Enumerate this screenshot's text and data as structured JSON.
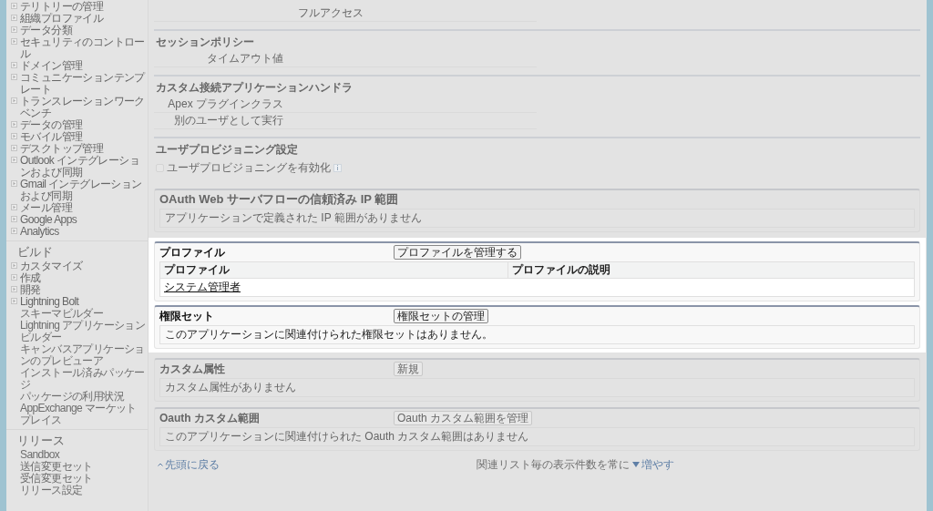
{
  "sidebar": {
    "groups": [
      {
        "items": [
          {
            "label": "テリトリーの管理",
            "kind": "folder"
          },
          {
            "label": "組織プロファイル",
            "kind": "folder"
          },
          {
            "label": "データ分類",
            "kind": "folder"
          },
          {
            "label": "セキュリティのコントロール",
            "kind": "folder"
          },
          {
            "label": "ドメイン管理",
            "kind": "folder"
          },
          {
            "label": "コミュニケーションテンプレート",
            "kind": "folder"
          },
          {
            "label": "トランスレーションワークベンチ",
            "kind": "folder"
          },
          {
            "label": "データの管理",
            "kind": "folder"
          },
          {
            "label": "モバイル管理",
            "kind": "folder"
          },
          {
            "label": "デスクトップ管理",
            "kind": "folder"
          },
          {
            "label": "Outlook インテグレーションおよび同期",
            "kind": "folder"
          },
          {
            "label": "Gmail インテグレーションおよび同期",
            "kind": "folder"
          },
          {
            "label": "メール管理",
            "kind": "folder"
          },
          {
            "label": "Google Apps",
            "kind": "folder"
          },
          {
            "label": "Analytics",
            "kind": "folder"
          }
        ]
      },
      {
        "title": "ビルド",
        "items": [
          {
            "label": "カスタマイズ",
            "kind": "folder"
          },
          {
            "label": "作成",
            "kind": "folder"
          },
          {
            "label": "開発",
            "kind": "folder"
          },
          {
            "label": "Lightning Bolt",
            "kind": "folder"
          },
          {
            "label": "スキーマビルダー",
            "kind": "link"
          },
          {
            "label": "Lightning アプリケーションビルダー",
            "kind": "link"
          },
          {
            "label": "キャンバスアプリケーションのプレビューア",
            "kind": "link"
          },
          {
            "label": "インストール済みパッケージ",
            "kind": "link"
          },
          {
            "label": "パッケージの利用状況",
            "kind": "link"
          },
          {
            "label": "AppExchange マーケットプレイス",
            "kind": "link"
          }
        ]
      },
      {
        "title": "リリース",
        "items": [
          {
            "label": "Sandbox",
            "kind": "link"
          },
          {
            "label": "送信変更セット",
            "kind": "link"
          },
          {
            "label": "受信変更セット",
            "kind": "link"
          },
          {
            "label": "リリース設定",
            "kind": "link"
          }
        ]
      }
    ]
  },
  "detail_sections": [
    {
      "rows": [
        {
          "value": "フルアクセス"
        }
      ]
    },
    {
      "title": "セッションポリシー",
      "rows": [
        {
          "label": "タイムアウト値"
        }
      ]
    },
    {
      "title": "カスタム接続アプリケーションハンドラ",
      "rows": [
        {
          "label": "Apex プラグインクラス"
        },
        {
          "label": "別のユーザとして実行"
        }
      ]
    },
    {
      "title": "ユーザプロビジョニング設定",
      "checkbox": {
        "label": "ユーザプロビジョニングを有効化",
        "checked": false
      }
    }
  ],
  "related_lists": [
    {
      "title": "OAuth Web サーバフローの信頼済み IP 範囲",
      "highlighted": false,
      "message": "アプリケーションで定義された IP 範囲がありません"
    },
    {
      "title": "プロファイル",
      "highlighted": true,
      "button": "プロファイルを管理する",
      "table": {
        "columns": [
          "プロファイル",
          "プロファイルの説明"
        ],
        "rows": [
          [
            "システム管理者",
            ""
          ]
        ]
      }
    },
    {
      "title": "権限セット",
      "highlighted": true,
      "button": "権限セットの管理",
      "message": "このアプリケーションに関連付けられた権限セットはありません。"
    },
    {
      "title": "カスタム属性",
      "highlighted": false,
      "button": "新規",
      "message": "カスタム属性がありません"
    },
    {
      "title": "Oauth カスタム範囲",
      "highlighted": false,
      "button": "Oauth カスタム範囲を管理",
      "message": "このアプリケーションに関連付けられた Oauth カスタム範囲はありません"
    }
  ],
  "footer": {
    "back_link": "先頭に戻る",
    "text": "関連リスト毎の表示件数を常に",
    "more_link": "増やす"
  }
}
